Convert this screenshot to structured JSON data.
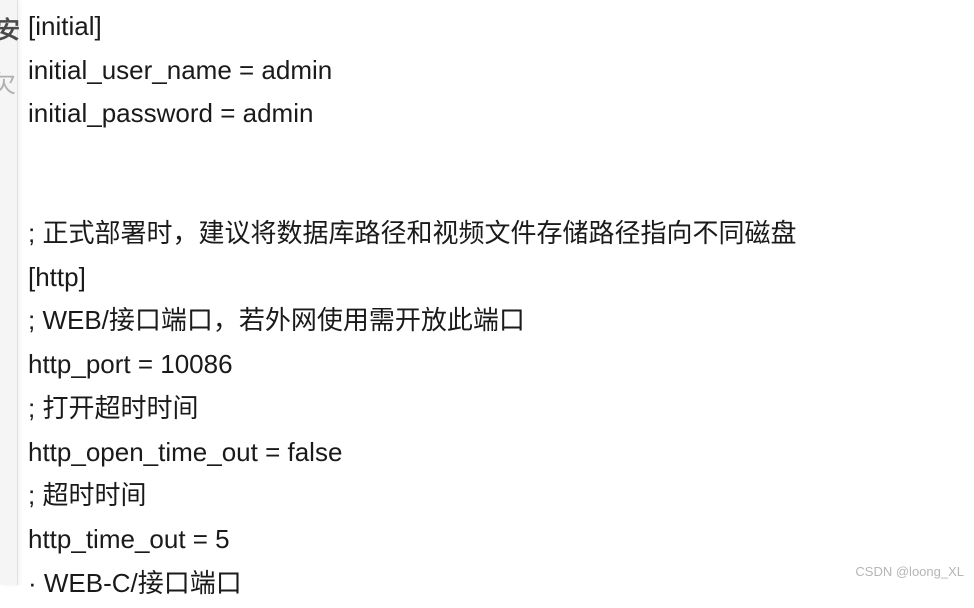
{
  "sidebar": {
    "partial_text_1": "安",
    "partial_text_2": "欠"
  },
  "config": {
    "lines": [
      "[initial]",
      "initial_user_name = admin",
      "initial_password = admin",
      "",
      "",
      "; 正式部署时，建议将数据库路径和视频文件存储路径指向不同磁盘",
      "[http]",
      "; WEB/接口端口，若外网使用需开放此端口",
      "http_port = 10086",
      "; 打开超时时间",
      "http_open_time_out = false",
      "; 超时时间",
      "http_time_out = 5",
      "· WEB-C/接口端口"
    ]
  },
  "watermark": "CSDN @loong_XL"
}
